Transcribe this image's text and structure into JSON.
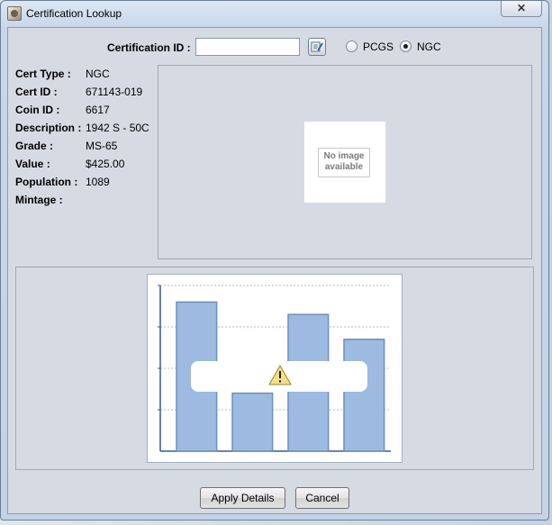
{
  "window": {
    "title": "Certification Lookup",
    "close_glyph": "✕"
  },
  "search": {
    "label": "Certification ID :",
    "value": "",
    "options": [
      {
        "label": "PCGS",
        "selected": false
      },
      {
        "label": "NGC",
        "selected": true
      }
    ]
  },
  "details": [
    {
      "label": "Cert Type :",
      "value": "NGC"
    },
    {
      "label": "Cert ID :",
      "value": "671143-019"
    },
    {
      "label": "Coin ID :",
      "value": "6617"
    },
    {
      "label": "Description :",
      "value": "1942 S - 50C"
    },
    {
      "label": "Grade :",
      "value": "MS-65"
    },
    {
      "label": "Value :",
      "value": "$425.00"
    },
    {
      "label": "Population :",
      "value": "1089"
    },
    {
      "label": "Mintage :",
      "value": ""
    }
  ],
  "image_placeholder": {
    "line1": "No image",
    "line2": "available"
  },
  "chart_data": {
    "type": "bar",
    "categories": [
      "",
      "",
      "",
      ""
    ],
    "values": [
      36,
      14,
      33,
      27
    ],
    "ylim": [
      0,
      40
    ],
    "grid": true,
    "bar_color": "#9dbbe0",
    "bar_edge_color": "#6e8fba",
    "overlay_icon": "warning-icon"
  },
  "buttons": {
    "apply_label": "Apply Details",
    "cancel_label": "Cancel"
  },
  "colors": {
    "panel": "#d6dbe3",
    "title_bg": "#dce7f3"
  }
}
